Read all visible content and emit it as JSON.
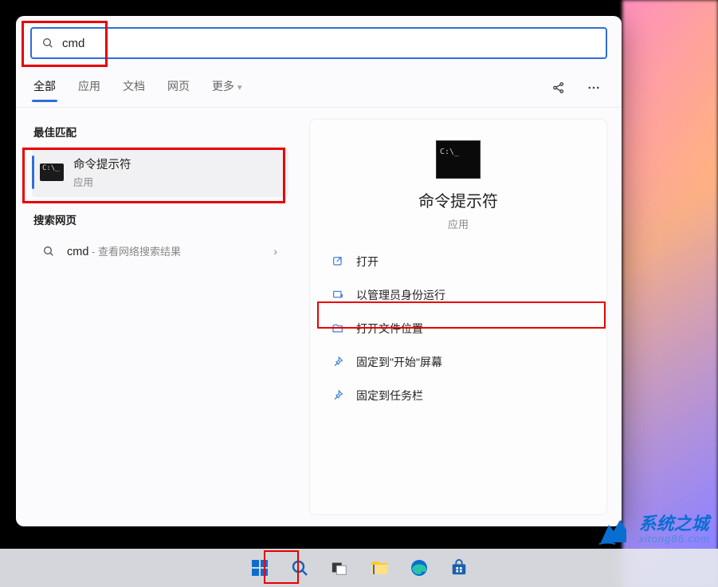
{
  "search": {
    "query": "cmd",
    "placeholder": ""
  },
  "tabs": {
    "all": "全部",
    "apps": "应用",
    "docs": "文档",
    "web": "网页",
    "more": "更多"
  },
  "sections": {
    "best_match": "最佳匹配",
    "search_web": "搜索网页"
  },
  "best_match": {
    "title": "命令提示符",
    "subtitle": "应用"
  },
  "web_search": {
    "term": "cmd",
    "suffix": " - 查看网络搜索结果"
  },
  "detail": {
    "title": "命令提示符",
    "subtitle": "应用",
    "actions": {
      "open": "打开",
      "run_admin": "以管理员身份运行",
      "open_location": "打开文件位置",
      "pin_start": "固定到\"开始\"屏幕",
      "pin_taskbar": "固定到任务栏"
    }
  },
  "watermark": {
    "cn": "系统之城",
    "en": "xitong86.com"
  },
  "icons": {
    "open": "open-external-icon",
    "admin": "shield-admin-icon",
    "folder": "folder-icon",
    "pin": "pin-icon",
    "search": "search-icon",
    "share": "share-icon",
    "more": "more-icon"
  }
}
